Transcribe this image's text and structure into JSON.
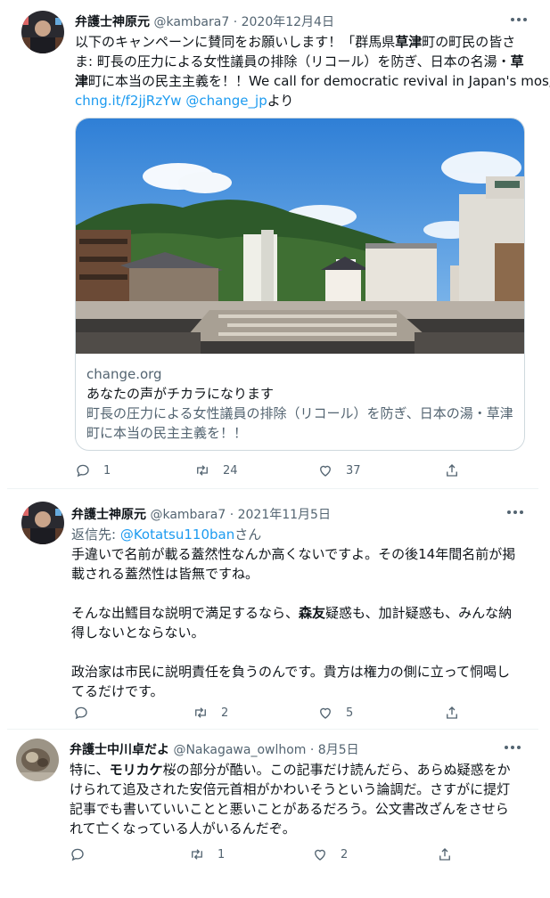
{
  "tweets": [
    {
      "name": "弁護士神原元",
      "handle": "@kambara7",
      "date": "2020年12月4日",
      "text_lines": [
        [
          "以下のキャンペーンに賛同をお願いします！「群馬県",
          {
            "b": "草津"
          },
          "町の町民の皆さ"
        ],
        [
          "ま: 町長の圧力による女性議員の排除（リコール）を防ぎ、日本の名湯・",
          {
            "b": "草"
          }
        ],
        [
          {
            "b": "津"
          },
          "町に本当の民主主義を！！We call for democratic revival in Japan's mos」"
        ]
      ],
      "link_line": {
        "link1": "chng.it/f2jjRzYw",
        "link2": "@change_jp",
        "suffix": "より"
      },
      "card": {
        "domain": "change.org",
        "title": "あなたの声がチカラになります",
        "desc1": "町長の圧力による女性議員の排除（リコール）を防ぎ、日本の湯・草津",
        "desc2": "町に本当の民主主義を！！"
      },
      "replies": "1",
      "retweets": "24",
      "likes": "37"
    },
    {
      "name": "弁護士神原元",
      "handle": "@kambara7",
      "date": "2021年11月5日",
      "reply_prefix": "返信先: ",
      "reply_handle": "@Kotatsu110ban",
      "reply_suffix": "さん",
      "lines": [
        "手違いで名前が載る蓋然性なんか高くないですよ。その後14年間名前が掲",
        "載される蓋然性は皆無ですね。",
        "",
        "",
        "得しないとならない。",
        "",
        "政治家は市民に説明責任を負うのんです。貴方は権力の側に立って恫喝し",
        "てるだけです。"
      ],
      "line4": {
        "a": "そんな出鱈目な説明で満足するなら、",
        "b": "森友",
        "c": "疑惑も、加計疑惑も、みんな納"
      },
      "replies": "",
      "retweets": "2",
      "likes": "5"
    },
    {
      "name": "弁護士中川卓だよ",
      "handle": "@Nakagawa_owlhom",
      "date": "8月5日",
      "line1": {
        "a": "特に、",
        "b": "モリカケ",
        "c": "桜の部分が酷い。この記事だけ読んだら、あらぬ疑惑をか"
      },
      "lines": [
        "けられて追及された安倍元首相がかわいそうという論調だ。さすがに提灯",
        "記事でも書いていいことと悪いことがあるだろう。公文書改ざんをさせら",
        "れて亡くなっている人がいるんだぞ。"
      ],
      "replies": "",
      "retweets": "1",
      "likes": "2"
    }
  ],
  "separator": "·",
  "icons": [
    "reply-icon",
    "retweet-icon",
    "like-icon",
    "share-icon",
    "more-icon"
  ],
  "colors": {
    "link": "#1d9bf0",
    "muted": "#536471",
    "text": "#0f1419",
    "border": "#cfd9de"
  }
}
